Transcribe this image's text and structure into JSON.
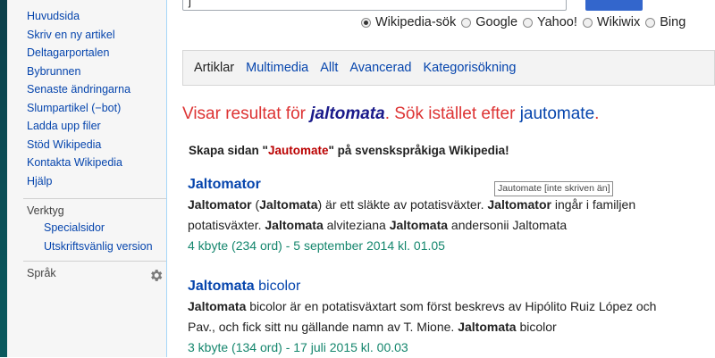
{
  "sidebar": {
    "nav": [
      "Huvudsida",
      "Skriv en ny artikel",
      "Deltagarportalen",
      "Bybrunnen",
      "Senaste ändringarna",
      "Slumpartikel (−bot)",
      "Ladda upp filer",
      "Stöd Wikipedia",
      "Kontakta Wikipedia",
      "Hjälp"
    ],
    "tools_title": "Verktyg",
    "tools": [
      "Specialsidor",
      "Utskriftsvänlig version"
    ],
    "languages_title": "Språk"
  },
  "search": {
    "query": "j",
    "engines": [
      {
        "label": "Wikipedia-sök",
        "selected": true
      },
      {
        "label": "Google",
        "selected": false
      },
      {
        "label": "Yahoo!",
        "selected": false
      },
      {
        "label": "Wikiwix",
        "selected": false
      },
      {
        "label": "Bing",
        "selected": false
      }
    ]
  },
  "tabs": [
    "Artiklar",
    "Multimedia",
    "Allt",
    "Avancerad",
    "Kategorisökning"
  ],
  "showing": {
    "prefix": "Visar resultat för ",
    "term": "jaltomata",
    "middle": ". Sök istället efter ",
    "alt": "jautomate",
    "end": "."
  },
  "create": {
    "prefix": "Skapa sidan \"",
    "page": "Jautomate",
    "suffix": "\" på svenskspråkiga Wikipedia!"
  },
  "tooltip": "Jautomate [inte skriven än]",
  "results": [
    {
      "title_bold": "Jaltomator",
      "title_rest": "",
      "line1": "Jaltomator (Jaltomata) är ett släkte av potatisväxter. Jaltomator ingår i familjen",
      "line2": "potatisväxter. Jaltomata alviteziana Jaltomata andersonii Jaltomata",
      "meta": "4 kbyte (234 ord) - 5 september 2014 kl. 01.05"
    },
    {
      "title_bold": "Jaltomata",
      "title_rest": " bicolor",
      "line1": "Jaltomata bicolor är en potatisväxtart som först beskrevs av Hipólito Ruiz López och",
      "line2": "Pav., och fick sitt nu gällande namn av T. Mione. Jaltomata bicolor",
      "meta": "3 kbyte (134 ord) - 17 juli 2015 kl. 00.03"
    }
  ]
}
